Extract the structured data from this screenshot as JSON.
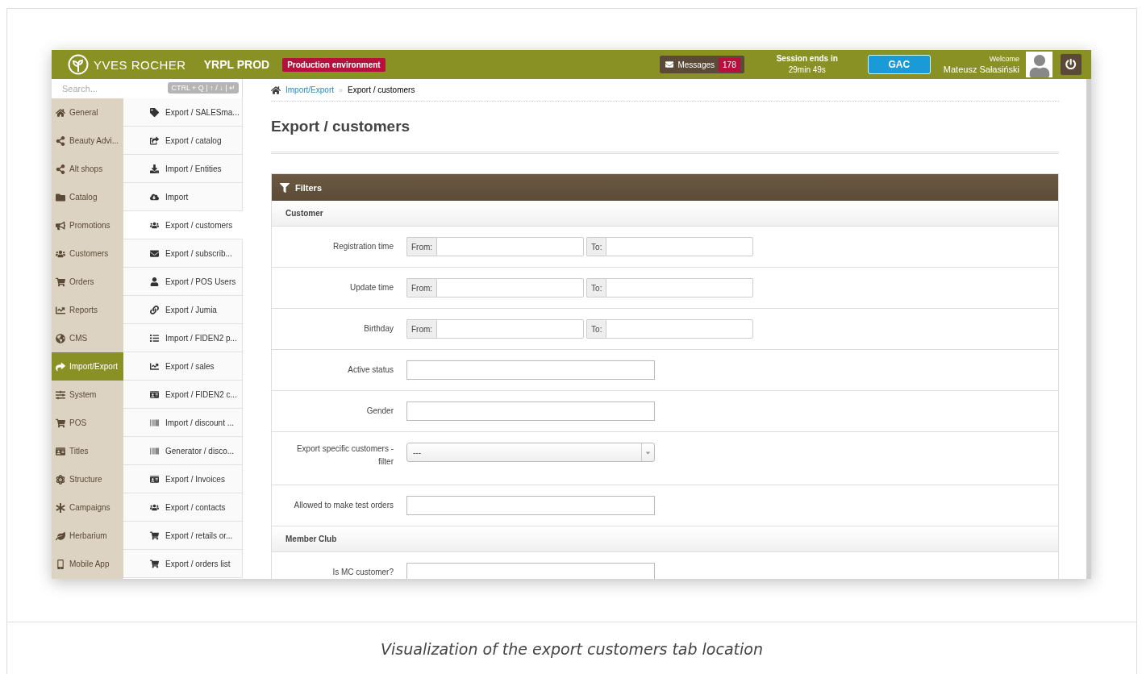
{
  "header": {
    "brand": "YVES ROCHER",
    "app_name": "YRPL PROD",
    "environment_badge": "Production environment",
    "messages": {
      "label": "Messages",
      "count": "178"
    },
    "session": {
      "title": "Session ends in",
      "time": "29min 49s"
    },
    "store_button": "GAC",
    "welcome": {
      "label": "Welcome",
      "name": "Mateusz Sałasiński"
    }
  },
  "search": {
    "placeholder": "Search...",
    "shortcut": "CTRL + Q | ↑ / ↓ | ↵"
  },
  "nav": [
    {
      "label": "General",
      "selected": false
    },
    {
      "label": "Beauty Advi...",
      "selected": false
    },
    {
      "label": "Alt shops",
      "selected": false
    },
    {
      "label": "Catalog",
      "selected": false
    },
    {
      "label": "Promotions",
      "selected": false
    },
    {
      "label": "Customers",
      "selected": false
    },
    {
      "label": "Orders",
      "selected": false
    },
    {
      "label": "Reports",
      "selected": false
    },
    {
      "label": "CMS",
      "selected": false
    },
    {
      "label": "Import/Export",
      "selected": true
    },
    {
      "label": "System",
      "selected": false
    },
    {
      "label": "POS",
      "selected": false
    },
    {
      "label": "Titles",
      "selected": false
    },
    {
      "label": "Structure",
      "selected": false
    },
    {
      "label": "Campaigns",
      "selected": false
    },
    {
      "label": "Herbarium",
      "selected": false
    },
    {
      "label": "Mobile App",
      "selected": false
    }
  ],
  "subnav": [
    {
      "label": "Export / SALESma...",
      "selected": false
    },
    {
      "label": "Export / catalog",
      "selected": false
    },
    {
      "label": "Import / Entities",
      "selected": false
    },
    {
      "label": "Import",
      "selected": false
    },
    {
      "label": "Export / customers",
      "selected": true
    },
    {
      "label": "Export / subscrib...",
      "selected": false
    },
    {
      "label": "Export / POS Users",
      "selected": false
    },
    {
      "label": "Export / Jumia",
      "selected": false
    },
    {
      "label": "Import / FIDEN2 p...",
      "selected": false
    },
    {
      "label": "Export / sales",
      "selected": false
    },
    {
      "label": "Export / FIDEN2 c...",
      "selected": false
    },
    {
      "label": "Import / discount ...",
      "selected": false
    },
    {
      "label": "Generator / disco...",
      "selected": false
    },
    {
      "label": "Export / Invoices",
      "selected": false
    },
    {
      "label": "Export / contacts",
      "selected": false
    },
    {
      "label": "Export / retails or...",
      "selected": false
    },
    {
      "label": "Export / orders list",
      "selected": false
    }
  ],
  "breadcrumb": {
    "link": "Import/Export",
    "separator": "»",
    "current": "Export / customers"
  },
  "title": "Export / customers",
  "panel": {
    "title": "Filters",
    "sections": [
      {
        "title": "Customer",
        "fields": [
          {
            "kind": "range",
            "label": "Registration time",
            "from_label": "From:",
            "to_label": "To:"
          },
          {
            "kind": "range",
            "label": "Update time",
            "from_label": "From:",
            "to_label": "To:"
          },
          {
            "kind": "range",
            "label": "Birthday",
            "from_label": "From:",
            "to_label": "To:"
          },
          {
            "kind": "text",
            "label": "Active status"
          },
          {
            "kind": "text",
            "label": "Gender"
          },
          {
            "kind": "select",
            "label": "Export specific customers - filter",
            "value": "---"
          },
          {
            "kind": "text",
            "label": "Allowed to make test orders"
          }
        ]
      },
      {
        "title": "Member Club",
        "fields": [
          {
            "kind": "text",
            "label": "Is MC customer?"
          }
        ]
      }
    ]
  },
  "caption": "Visualization of the export customers tab location"
}
